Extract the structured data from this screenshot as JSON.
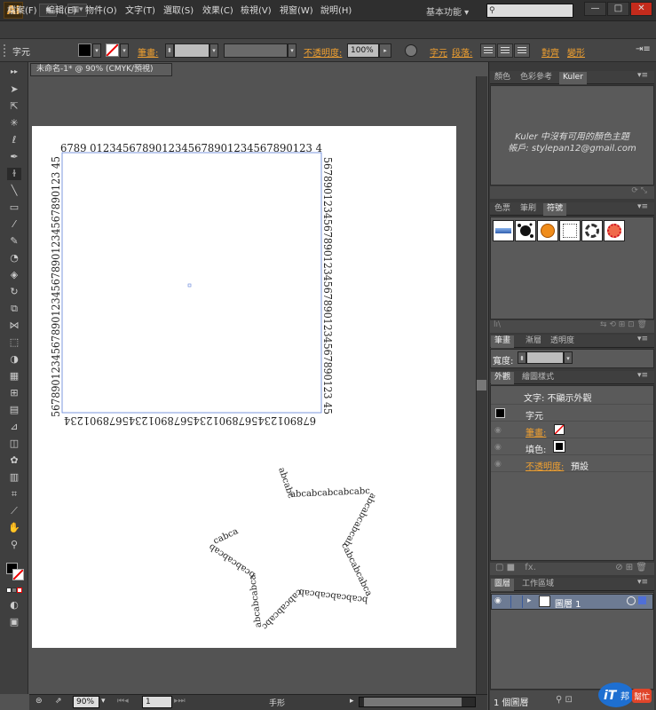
{
  "app": {
    "logo": "Ai",
    "workspace": "基本功能",
    "search_placeholder": "",
    "window_buttons": {
      "minimize": "—",
      "maximize": "□",
      "close": "✕"
    }
  },
  "menu": [
    "檔案(F)",
    "編輯(E)",
    "物件(O)",
    "文字(T)",
    "選取(S)",
    "效果(C)",
    "檢視(V)",
    "視窗(W)",
    "說明(H)"
  ],
  "control": {
    "label": "字元",
    "stroke_label": "筆畫:",
    "opacity_label": "不透明度:",
    "opacity_value": "100%",
    "char_link": "字元",
    "para_link": "段落:",
    "align_link": "對齊",
    "transform_link": "變形"
  },
  "document": {
    "tab_title": "未命名-1* @ 90% (CMYK/預視)",
    "top_text": "6789  0123456789012345678901234567890123 4",
    "right_text": "567890123456789012345678901234567890123 45",
    "bottom_text": "678901234567890123456789012345678901234",
    "left_text": "567890123456789012345678901234567890123 45",
    "star_text": "abcabcabcabcabcabcabcabcabcabcabcabcabcabcabcabcabcabcabcabcabcabcabcabcabcabcabcabcabcabca"
  },
  "status": {
    "zoom": "90%",
    "page": "1",
    "tool_name": "手形"
  },
  "panels": {
    "top_tabs": [
      "顏色",
      "色彩參考",
      "Kuler"
    ],
    "kuler_line1": "Kuler 中沒有可用的顏色主題",
    "kuler_line2": "帳戶: stylepan12@gmail.com",
    "symbol_tabs": [
      "色票",
      "筆刷",
      "符號"
    ],
    "stroke_tabs": [
      "筆畫",
      "漸層",
      "透明度"
    ],
    "stroke_width_label": "寬度:",
    "appearance_tabs": [
      "外觀",
      "繪圖樣式"
    ],
    "appearance_header": "文字: 不顯示外觀",
    "appearance_rows": [
      {
        "label": "字元"
      },
      {
        "label": "筆畫:"
      },
      {
        "label": "填色:"
      },
      {
        "label": "不透明度:",
        "value": "預設"
      }
    ],
    "layer_tabs": [
      "圖層",
      "工作區域"
    ],
    "layer_name": "圖層 1",
    "layer_count": "1 個圖層"
  },
  "watermark": {
    "line1": "iT",
    "line2": "邦",
    "line3": "幫忙"
  }
}
